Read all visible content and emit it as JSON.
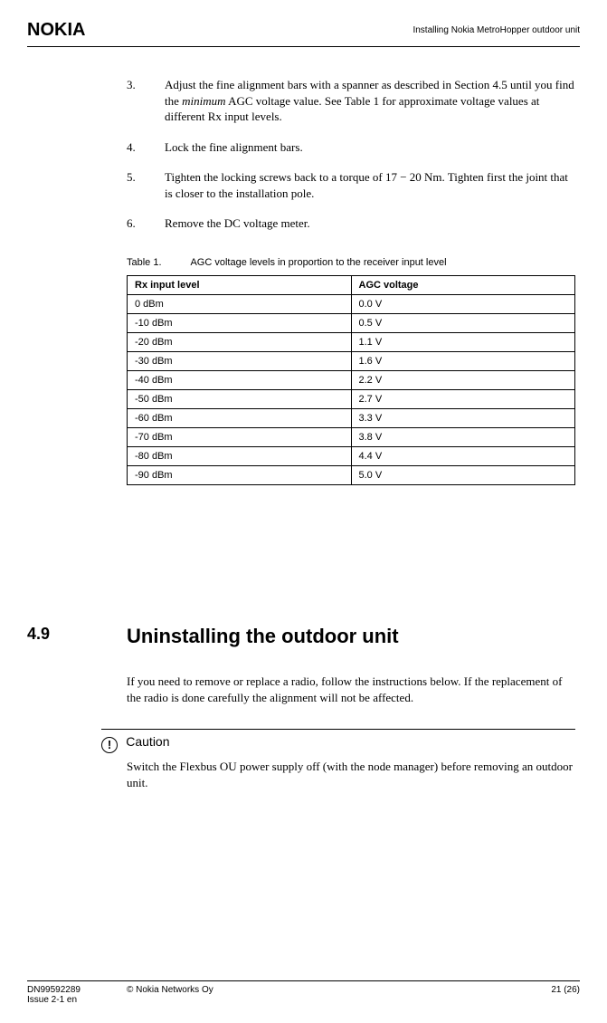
{
  "header": {
    "logo": "NOKIA",
    "title": "Installing Nokia MetroHopper outdoor unit"
  },
  "steps": [
    {
      "num": "3.",
      "body_a": "Adjust the fine alignment bars with a spanner as described in Section 4.5 until you find the ",
      "body_i": "minimum",
      "body_b": " AGC voltage value. See Table 1 for approximate voltage values at different Rx input levels."
    },
    {
      "num": "4.",
      "body_a": "Lock the fine alignment bars.",
      "body_i": "",
      "body_b": ""
    },
    {
      "num": "5.",
      "body_a": "Tighten the locking screws back to a torque of 17 − 20 Nm. Tighten first the joint that is closer to the installation pole.",
      "body_i": "",
      "body_b": ""
    },
    {
      "num": "6.",
      "body_a": "Remove the DC voltage meter.",
      "body_i": "",
      "body_b": ""
    }
  ],
  "table": {
    "caption_label": "Table 1.",
    "caption_text": "AGC voltage levels in proportion to the receiver input level",
    "headers": {
      "col1": "Rx input level",
      "col2": "AGC voltage"
    },
    "rows": [
      {
        "c1": "0 dBm",
        "c2": "0.0 V"
      },
      {
        "c1": "-10 dBm",
        "c2": "0.5 V"
      },
      {
        "c1": "-20 dBm",
        "c2": "1.1 V"
      },
      {
        "c1": "-30 dBm",
        "c2": "1.6 V"
      },
      {
        "c1": "-40 dBm",
        "c2": "2.2 V"
      },
      {
        "c1": "-50 dBm",
        "c2": "2.7 V"
      },
      {
        "c1": "-60 dBm",
        "c2": "3.3 V"
      },
      {
        "c1": "-70 dBm",
        "c2": "3.8 V"
      },
      {
        "c1": "-80 dBm",
        "c2": "4.4 V"
      },
      {
        "c1": "-90 dBm",
        "c2": "5.0 V"
      }
    ]
  },
  "section": {
    "num": "4.9",
    "title": "Uninstalling the outdoor unit",
    "para": "If you need to remove or replace a radio, follow the instructions below. If the replacement of the radio is done carefully the alignment will not be affected."
  },
  "caution": {
    "icon_glyph": "!",
    "label": "Caution",
    "text": "Switch the Flexbus OU power supply off (with the node manager) before removing an outdoor unit."
  },
  "footer": {
    "doc_id": "DN99592289",
    "issue": "Issue 2-1 en",
    "copyright": "© Nokia Networks Oy",
    "page": "21 (26)"
  }
}
